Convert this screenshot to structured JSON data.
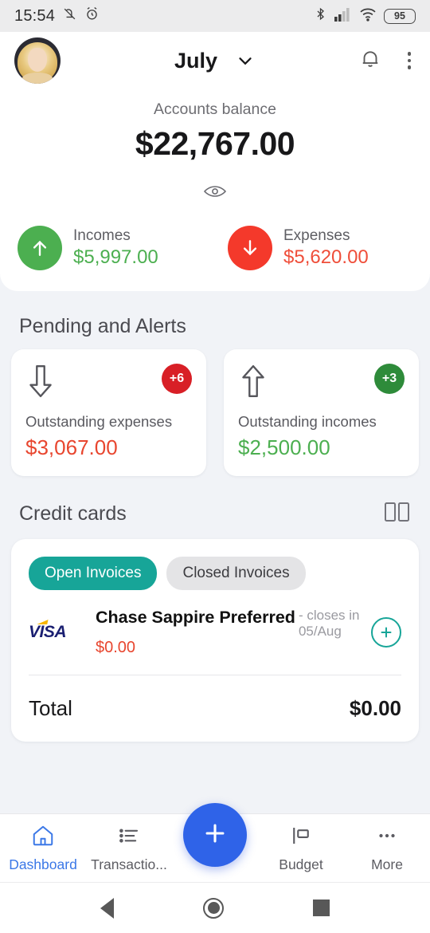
{
  "statusbar": {
    "time": "15:54",
    "icons": [
      "bell-off-icon",
      "alarm-icon",
      "bluetooth-icon",
      "signal-icon",
      "wifi-icon"
    ],
    "battery_level": "95"
  },
  "header": {
    "avatar_alt": "user-avatar",
    "month": "July",
    "chevron": "chevron-down-icon",
    "bell": "bell-icon",
    "overflow": "overflow-menu-icon"
  },
  "balance": {
    "label": "Accounts balance",
    "amount": "$22,767.00",
    "toggle_icon": "eye-icon",
    "incomes": {
      "label": "Incomes",
      "amount": "$5,997.00",
      "icon": "arrow-up-icon",
      "color": "#4CAF50"
    },
    "expenses": {
      "label": "Expenses",
      "amount": "$5,620.00",
      "icon": "arrow-down-icon",
      "color": "#F4392B"
    }
  },
  "pending": {
    "title": "Pending and Alerts",
    "cards": [
      {
        "icon": "arrow-down-outline-icon",
        "badge": "+6",
        "badge_color": "#D81F26",
        "label": "Outstanding expenses",
        "amount": "$3,067.00",
        "amount_color": "#E8462F"
      },
      {
        "icon": "arrow-up-outline-icon",
        "badge": "+3",
        "badge_color": "#2E8B3A",
        "label": "Outstanding incomes",
        "amount": "$2,500.00",
        "amount_color": "#4CAF50"
      }
    ]
  },
  "credit_cards": {
    "title": "Credit cards",
    "view_icon": "cards-view-icon",
    "tabs": [
      {
        "label": "Open Invoices",
        "active": true
      },
      {
        "label": "Closed Invoices",
        "active": false
      }
    ],
    "rows": [
      {
        "brand": "VISA",
        "name": "Chase Sappire Preferred",
        "closes": "- closes in 05/Aug",
        "amount": "$0.00",
        "action_icon": "plus-circle-icon"
      }
    ],
    "total_label": "Total",
    "total_value": "$0.00",
    "accent": "#17A598"
  },
  "bottomnav": {
    "items": [
      {
        "label": "Dashboard",
        "icon": "home-icon",
        "active": true
      },
      {
        "label": "Transactio...",
        "icon": "list-icon",
        "active": false
      },
      {
        "label": "Budget",
        "icon": "budget-icon",
        "active": false
      },
      {
        "label": "More",
        "icon": "more-icon",
        "active": false
      }
    ],
    "fab_icon": "plus-icon",
    "fab_color": "#2F63E8",
    "active_color": "#3B78E7"
  },
  "sysnav": {
    "back": "back-icon",
    "home": "home-circle-icon",
    "recents": "recents-icon"
  }
}
